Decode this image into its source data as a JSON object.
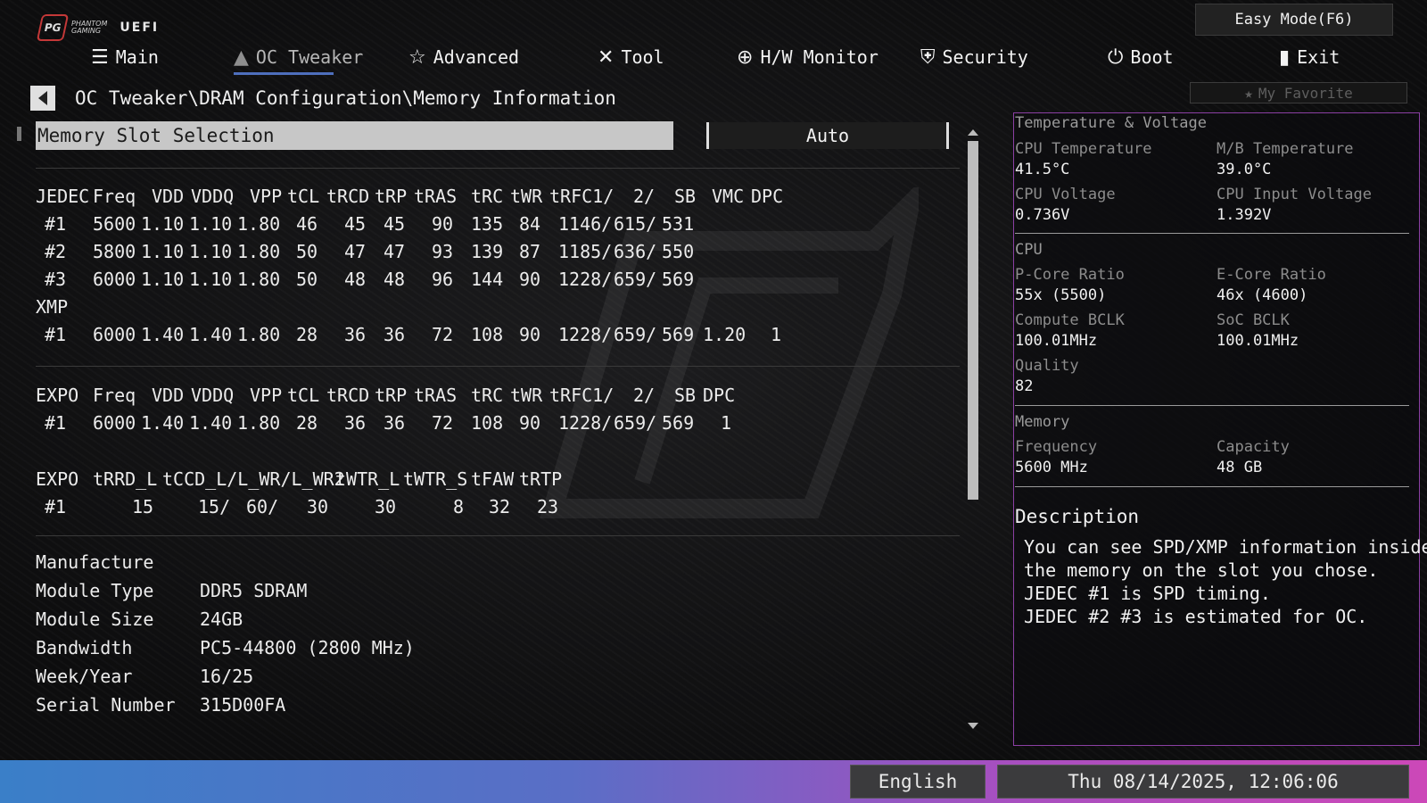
{
  "header": {
    "brand_line1": "PHANTOM",
    "brand_line2": "GAMING",
    "uefi_label": "UEFI",
    "easy_mode": "Easy Mode(F6)",
    "favorite": "My Favorite"
  },
  "nav": {
    "tabs": [
      {
        "label": "Main",
        "icon": "list-icon"
      },
      {
        "label": "OC Tweaker",
        "icon": "rocket-icon",
        "active": true
      },
      {
        "label": "Advanced",
        "icon": "star-icon"
      },
      {
        "label": "Tool",
        "icon": "tools-icon"
      },
      {
        "label": "H/W Monitor",
        "icon": "target-icon"
      },
      {
        "label": "Security",
        "icon": "shield-icon"
      },
      {
        "label": "Boot",
        "icon": "power-icon"
      },
      {
        "label": "Exit",
        "icon": "door-icon"
      }
    ]
  },
  "breadcrumb": "OC Tweaker\\DRAM Configuration\\Memory Information",
  "slot_selection": {
    "label": "Memory Slot Selection",
    "value": "Auto"
  },
  "jedec": {
    "header": [
      "JEDEC",
      "Freq",
      "VDD",
      "VDDQ",
      "VPP",
      "tCL",
      "tRCD",
      "tRP",
      "tRAS",
      "tRC",
      "tWR",
      "tRFC1/",
      "2/",
      "SB",
      "VMC",
      "DPC"
    ],
    "rows": [
      [
        "#1",
        "5600",
        "1.10",
        "1.10",
        "1.80",
        "46",
        "45",
        "45",
        "90",
        "135",
        "84",
        "1146/",
        "615/",
        "531",
        "",
        ""
      ],
      [
        "#2",
        "5800",
        "1.10",
        "1.10",
        "1.80",
        "50",
        "47",
        "47",
        "93",
        "139",
        "87",
        "1185/",
        "636/",
        "550",
        "",
        ""
      ],
      [
        "#3",
        "6000",
        "1.10",
        "1.10",
        "1.80",
        "50",
        "48",
        "48",
        "96",
        "144",
        "90",
        "1228/",
        "659/",
        "569",
        "",
        ""
      ]
    ]
  },
  "xmp": {
    "header": "XMP",
    "rows": [
      [
        "#1",
        "6000",
        "1.40",
        "1.40",
        "1.80",
        "28",
        "36",
        "36",
        "72",
        "108",
        "90",
        "1228/",
        "659/",
        "569",
        "1.20",
        "1"
      ]
    ]
  },
  "expo": {
    "header": [
      "EXPO",
      "Freq",
      "VDD",
      "VDDQ",
      "VPP",
      "tCL",
      "tRCD",
      "tRP",
      "tRAS",
      "tRC",
      "tWR",
      "tRFC1/",
      "2/",
      "SB",
      "DPC"
    ],
    "rows": [
      [
        "#1",
        "6000",
        "1.40",
        "1.40",
        "1.80",
        "28",
        "36",
        "36",
        "72",
        "108",
        "90",
        "1228/",
        "659/",
        "569",
        "1"
      ]
    ]
  },
  "expo2": {
    "header": [
      "EXPO",
      "tRRD_L",
      "tCCD_L/L_WR/L_WR2",
      "tWTR_L",
      "tWTR_S",
      "tFAW",
      "tRTP"
    ],
    "rows": [
      [
        "#1",
        "15",
        "15/",
        "60/",
        "30",
        "30",
        "8",
        "32",
        "23"
      ]
    ]
  },
  "module_info": {
    "manufacture_label": "Manufacture",
    "items": [
      {
        "key": "Module Type",
        "value": "DDR5 SDRAM"
      },
      {
        "key": "Module Size",
        "value": "24GB"
      },
      {
        "key": "Bandwidth",
        "value": "PC5-44800 (2800 MHz)"
      },
      {
        "key": "Week/Year",
        "value": "16/25"
      },
      {
        "key": "Serial Number",
        "value": "315D00FA"
      }
    ]
  },
  "hw": {
    "title": "Temperature & Voltage",
    "cpu_temp_label": "CPU Temperature",
    "cpu_temp": "41.5°C",
    "mb_temp_label": "M/B Temperature",
    "mb_temp": "39.0°C",
    "cpu_volt_label": "CPU Voltage",
    "cpu_volt": "0.736V",
    "cpu_in_volt_label": "CPU Input Voltage",
    "cpu_in_volt": "1.392V",
    "cpu_section": "CPU",
    "pcore_label": "P-Core Ratio",
    "pcore": "55x (5500)",
    "ecore_label": "E-Core Ratio",
    "ecore": "46x (4600)",
    "cbclk_label": "Compute BCLK",
    "cbclk": "100.01MHz",
    "socbclk_label": "SoC BCLK",
    "socbclk": "100.01MHz",
    "quality_label": "Quality",
    "quality": "82",
    "memory_section": "Memory",
    "freq_label": "Frequency",
    "freq": "5600 MHz",
    "cap_label": "Capacity",
    "cap": "48 GB"
  },
  "description": {
    "title": "Description",
    "lines": [
      "You can see SPD/XMP information inside",
      "the memory on the slot you chose.",
      "JEDEC #1 is SPD timing.",
      "JEDEC #2 #3 is estimated for OC."
    ]
  },
  "footer": {
    "language": "English",
    "datetime": "Thu 08/14/2025, 12:06:06"
  },
  "colors": {
    "accent": "#4e6fbd",
    "panel_border": "#8b3fa3",
    "footer_start": "#3a7fc8",
    "footer_end": "#cc48b8"
  }
}
